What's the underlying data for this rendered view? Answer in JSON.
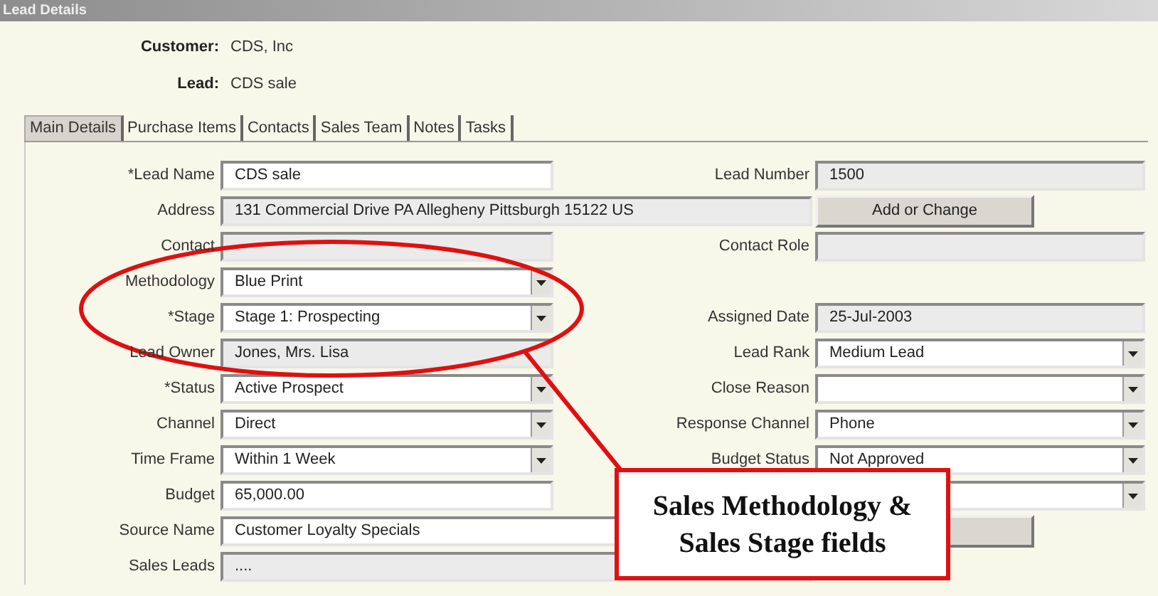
{
  "window": {
    "title": "Lead Details"
  },
  "header": [
    {
      "label": "Customer:",
      "value": "CDS, Inc"
    },
    {
      "label": "Lead:",
      "value": "CDS sale"
    }
  ],
  "tabs": [
    {
      "label": "Main Details",
      "selected": true
    },
    {
      "label": "Purchase Items",
      "selected": false
    },
    {
      "label": "Contacts",
      "selected": false
    },
    {
      "label": "Sales Team",
      "selected": false
    },
    {
      "label": "Notes",
      "selected": false
    },
    {
      "label": "Tasks",
      "selected": false
    }
  ],
  "rows": [
    {
      "left": {
        "label": "*Lead Name",
        "kind": "text",
        "value": "CDS sale"
      },
      "right": {
        "label": "Lead Number",
        "kind": "readonly",
        "value": "1500"
      }
    },
    {
      "left": {
        "label": "Address",
        "kind": "readonly",
        "wide": true,
        "value": "131 Commercial Drive PA Allegheny Pittsburgh 15122 US"
      },
      "right": {
        "kind": "button",
        "label": "Add or Change"
      }
    },
    {
      "left": {
        "label": "Contact",
        "kind": "readonly"
      },
      "right": {
        "label": "Contact Role",
        "kind": "readonly"
      }
    },
    {
      "left": {
        "label": "Methodology",
        "kind": "select",
        "value": "Blue Print"
      }
    },
    {
      "left": {
        "label": "*Stage",
        "kind": "select",
        "value": "Stage 1: Prospecting"
      },
      "right": {
        "label": "Assigned Date",
        "kind": "readonly",
        "value": "25-Jul-2003"
      }
    },
    {
      "left": {
        "label": "Lead Owner",
        "kind": "readonly",
        "value": "Jones, Mrs. Lisa"
      },
      "right": {
        "label": "Lead Rank",
        "kind": "select",
        "value": "Medium Lead"
      }
    },
    {
      "left": {
        "label": "*Status",
        "kind": "select",
        "value": "Active Prospect"
      },
      "right": {
        "label": "Close Reason",
        "kind": "select"
      }
    },
    {
      "left": {
        "label": "Channel",
        "kind": "select",
        "value": "Direct"
      },
      "right": {
        "label": "Response Channel",
        "kind": "select",
        "value": "Phone"
      }
    },
    {
      "left": {
        "label": "Time Frame",
        "kind": "select",
        "value": "Within 1 Week"
      },
      "right": {
        "label": "Budget Status",
        "kind": "select",
        "value": "Not Approved"
      }
    },
    {
      "left": {
        "label": "Budget",
        "kind": "text",
        "value": "65,000.00"
      },
      "right": {
        "kind": "select"
      }
    },
    {
      "left": {
        "label": "Source Name",
        "kind": "text",
        "wide": true,
        "value": "Customer Loyalty Specials"
      },
      "right": {
        "kind": "button"
      }
    },
    {
      "left": {
        "label": "Sales Leads",
        "kind": "readonly",
        "wide": true,
        "value": "...."
      }
    }
  ],
  "callout": {
    "text": "Sales Methodology & Sales Stage fields"
  }
}
